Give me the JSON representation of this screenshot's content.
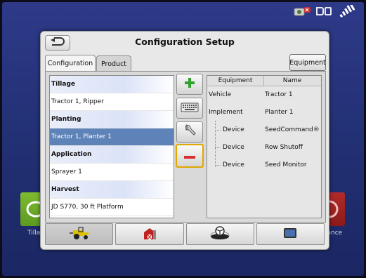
{
  "dialog": {
    "title": "Configuration Setup"
  },
  "tabs": [
    {
      "label": "Configuration"
    },
    {
      "label": "Product"
    }
  ],
  "equipment_button": {
    "label": "Equipment"
  },
  "config_list": [
    {
      "label": "Tillage",
      "type": "header"
    },
    {
      "label": "Tractor 1, Ripper",
      "type": "item"
    },
    {
      "label": "Planting",
      "type": "header"
    },
    {
      "label": "Tractor 1, Planter 1",
      "type": "selected"
    },
    {
      "label": "Application",
      "type": "header"
    },
    {
      "label": "Sprayer 1",
      "type": "item"
    },
    {
      "label": "Harvest",
      "type": "header"
    },
    {
      "label": "JD S770, 30 ft Platform",
      "type": "item"
    }
  ],
  "equipment_table": {
    "columns": [
      "Equipment",
      "Name"
    ],
    "rows": [
      {
        "equipment": "Vehicle",
        "name": "Tractor 1",
        "indent": false
      },
      {
        "equipment": "Implement",
        "name": "Planter 1",
        "indent": false
      },
      {
        "equipment": "Device",
        "name": "SeedCommand®",
        "indent": true
      },
      {
        "equipment": "Device",
        "name": "Row Shutoff",
        "indent": true
      },
      {
        "equipment": "Device",
        "name": "Seed Monitor",
        "indent": true
      }
    ]
  },
  "background": {
    "left_label": "Tilla",
    "right_label": "lance"
  },
  "colors": {
    "selected_row": "#5e83b8",
    "highlight_border": "#e0a800",
    "add_green": "#2ea22e",
    "remove_red": "#d63030",
    "screen_blue": "#233176"
  },
  "icons": {
    "back": "u-turn-arrow-icon",
    "add": "plus-icon",
    "keyboard": "keyboard-icon",
    "settings": "wrench-icon",
    "remove": "minus-icon",
    "bottom_tabs": [
      "tractor-icon",
      "barn-icon",
      "steering-wheel-icon",
      "display-icon"
    ]
  }
}
